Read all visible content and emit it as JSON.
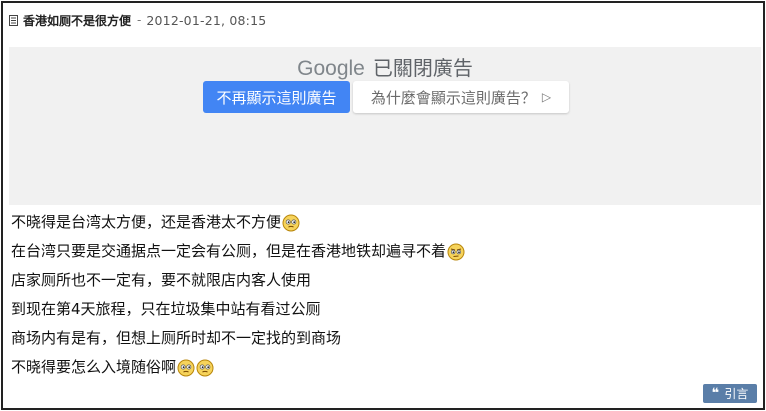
{
  "post": {
    "title": "香港如厕不是很方便",
    "separator": "-",
    "datetime": "2012-01-21, 08:15"
  },
  "ad": {
    "brand": "Google",
    "status": "已關閉廣告",
    "stop_button": "不再顯示這則廣告",
    "why_button": "為什麼會顯示這則廣告？",
    "why_icon": "play-outline-icon"
  },
  "body": {
    "lines": [
      "不晓得是台湾太方便，还是香港太不方便",
      "在台湾只要是交通据点一定会有公厕，但是在香港地铁却遍寻不着",
      "店家厕所也不一定有，要不就限店内客人使用",
      "到现在第4天旅程，只在垃圾集中站有看过公厕",
      "商场内有是有，但想上厕所时却不一定找的到商场",
      "不晓得要怎么入境随俗啊"
    ]
  },
  "actions": {
    "quote_label": "引言",
    "quote_icon": "quote-icon"
  },
  "colors": {
    "google_blue": "#4285f4",
    "quote_button": "#5a7ea8",
    "ad_background": "#f1f1f1"
  }
}
